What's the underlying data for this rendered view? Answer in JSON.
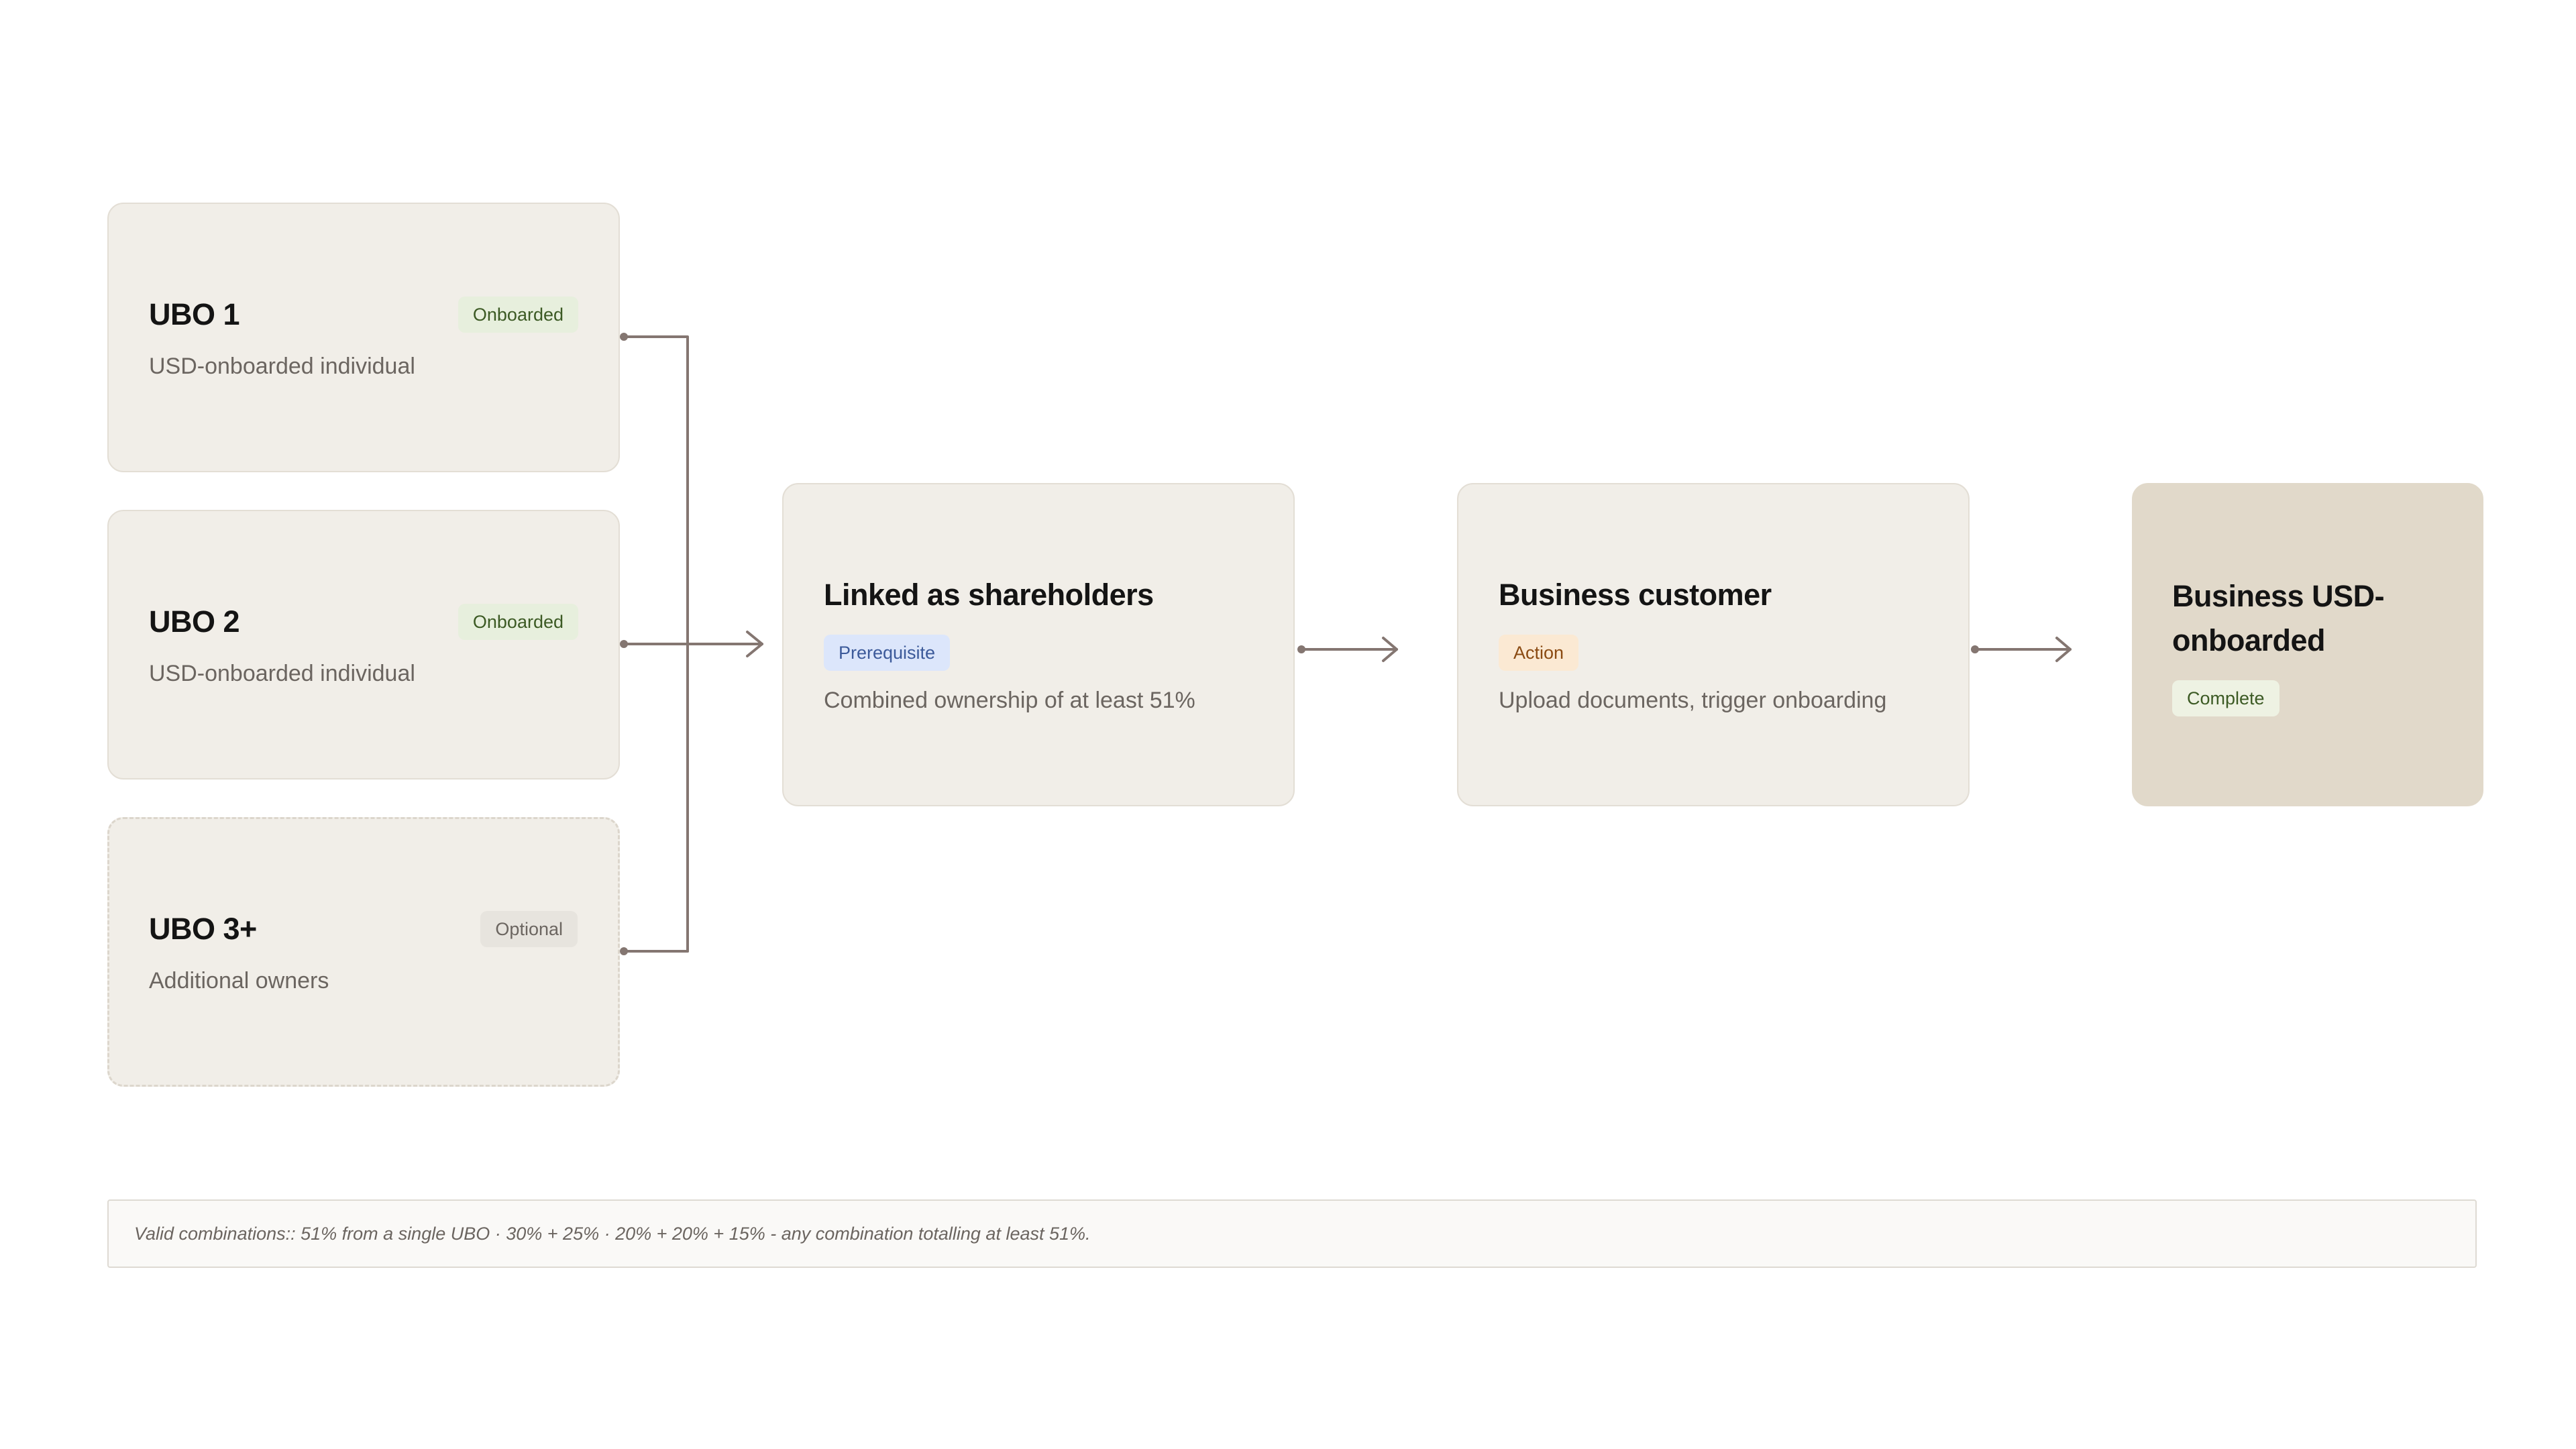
{
  "ubo_cards": [
    {
      "title": "UBO 1",
      "badge": "Onboarded",
      "desc": "USD-onboarded individual"
    },
    {
      "title": "UBO 2",
      "badge": "Onboarded",
      "desc": "USD-onboarded individual"
    },
    {
      "title": "UBO 3+",
      "badge": "Optional",
      "desc": "Additional owners"
    }
  ],
  "steps": [
    {
      "title": "Linked as shareholders",
      "badge": "Prerequisite",
      "desc": "Combined ownership of at least 51%"
    },
    {
      "title": "Business customer",
      "badge": "Action",
      "desc": "Upload documents, trigger onboarding"
    }
  ],
  "final": {
    "title_line1": "Business USD-",
    "title_line2": "onboarded",
    "badge": "Complete"
  },
  "note": {
    "text": "Valid combinations:: 51% from a single UBO · 30% + 25% · 20% + 20% + 15% - any combination totalling at least 51%."
  },
  "colors": {
    "card_bg": "#f1eee8",
    "final_bg": "#e1d9ca",
    "connector": "#847671",
    "badge_green": "#e7efdd",
    "badge_blue": "#dce6fb",
    "badge_orange": "#fbe9d3"
  }
}
